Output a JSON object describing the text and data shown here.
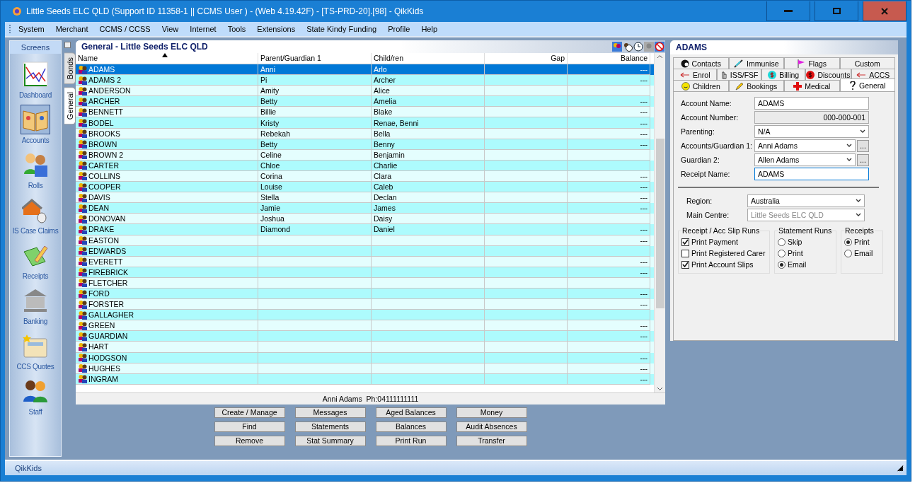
{
  "window": {
    "title": "Little Seeds ELC QLD (Support ID 11358-1 || CCMS User ) - (Web 4.19.42F) - [TS-PRD-20].[98] - QikKids"
  },
  "menu": [
    "System",
    "Merchant",
    "CCMS / CCSS",
    "View",
    "Internet",
    "Tools",
    "Extensions",
    "State Kindy Funding",
    "Profile",
    "Help"
  ],
  "sidebar": {
    "title": "Screens",
    "items": [
      {
        "label": "Dashboard",
        "kind": "chart",
        "selected": false
      },
      {
        "label": "Accounts",
        "kind": "book",
        "selected": true
      },
      {
        "label": "Rolls",
        "kind": "people",
        "selected": false
      },
      {
        "label": "IS Case Claims",
        "kind": "house",
        "selected": false
      },
      {
        "label": "Receipts",
        "kind": "pencil",
        "selected": false
      },
      {
        "label": "Banking",
        "kind": "bank",
        "selected": false
      },
      {
        "label": "CCS Quotes",
        "kind": "calc",
        "selected": false
      },
      {
        "label": "Staff",
        "kind": "staff",
        "selected": false
      }
    ]
  },
  "select_all": {
    "checked": false
  },
  "side_tabs": [
    {
      "label": "Bonds",
      "selected": false
    },
    {
      "label": "General",
      "selected": true
    }
  ],
  "list": {
    "title": "General - Little Seeds ELC QLD",
    "columns": [
      "Name",
      "Parent/Guardian 1",
      "Child/ren",
      "Gap",
      "Balance"
    ],
    "rows": [
      {
        "name": "ADAMS",
        "parent": "Anni",
        "children": "Arlo",
        "balance": "---",
        "selected": true
      },
      {
        "name": "ADAMS 2",
        "parent": "Pi",
        "children": "Archer",
        "balance": "---",
        "selected": false
      },
      {
        "name": "ANDERSON",
        "parent": "Amity",
        "children": "Alice",
        "selected": false
      },
      {
        "name": "ARCHER",
        "parent": "Betty",
        "children": "Amelia",
        "balance": "---",
        "selected": false
      },
      {
        "name": "BENNETT",
        "parent": "Billie",
        "children": "Blake",
        "balance": "---",
        "selected": false
      },
      {
        "name": "BODEL",
        "parent": "Kristy",
        "children": "Renae, Benni",
        "balance": "---",
        "selected": false
      },
      {
        "name": "BROOKS",
        "parent": "Rebekah",
        "children": "Bella",
        "balance": "---",
        "selected": false
      },
      {
        "name": "BROWN",
        "parent": "Betty",
        "children": "Benny",
        "balance": "---",
        "selected": false
      },
      {
        "name": "BROWN 2",
        "parent": "Celine",
        "children": "Benjamin",
        "selected": false
      },
      {
        "name": "CARTER",
        "parent": "Chloe",
        "children": "Charlie",
        "selected": false
      },
      {
        "name": "COLLINS",
        "parent": "Corina",
        "children": "Clara",
        "balance": "---",
        "selected": false
      },
      {
        "name": "COOPER",
        "parent": "Louise",
        "children": "Caleb",
        "balance": "---",
        "selected": false
      },
      {
        "name": "DAVIS",
        "parent": "Stella",
        "children": "Declan",
        "balance": "---",
        "selected": false
      },
      {
        "name": "DEAN",
        "parent": "Jamie",
        "children": "James",
        "balance": "---",
        "selected": false
      },
      {
        "name": "DONOVAN",
        "parent": "Joshua",
        "children": "Daisy",
        "selected": false
      },
      {
        "name": "DRAKE",
        "parent": "Diamond",
        "children": "Daniel",
        "balance": "---",
        "selected": false
      },
      {
        "name": "EASTON",
        "balance": "---",
        "selected": false
      },
      {
        "name": "EDWARDS",
        "selected": false
      },
      {
        "name": "EVERETT",
        "balance": "---",
        "selected": false
      },
      {
        "name": "FIREBRICK",
        "balance": "---",
        "selected": false
      },
      {
        "name": "FLETCHER",
        "selected": false
      },
      {
        "name": "FORD",
        "balance": "---",
        "selected": false
      },
      {
        "name": "FORSTER",
        "balance": "---",
        "selected": false
      },
      {
        "name": "GALLAGHER",
        "selected": false
      },
      {
        "name": "GREEN",
        "balance": "---",
        "selected": false
      },
      {
        "name": "GUARDIAN",
        "balance": "---",
        "selected": false
      },
      {
        "name": "HART",
        "selected": false
      },
      {
        "name": "HODGSON",
        "balance": "---",
        "selected": false
      },
      {
        "name": "HUGHES",
        "balance": "---",
        "selected": false
      },
      {
        "name": "INGRAM",
        "balance": "---",
        "selected": false
      }
    ],
    "footer": "Anni Adams  Ph:04111111111"
  },
  "buttons": [
    [
      "Create / Manage",
      "Messages",
      "Aged Balances",
      "Money"
    ],
    [
      "Find",
      "Statements",
      "Balances",
      "Audit Absences"
    ],
    [
      "Remove",
      "Stat Summary",
      "Print Run",
      "Transfer"
    ]
  ],
  "detail": {
    "title": "ADAMS",
    "tab_rows": [
      [
        {
          "label": "Contacts",
          "kind": "head",
          "selected": false
        },
        {
          "label": "Immunise",
          "kind": "syringe",
          "selected": false
        },
        {
          "label": "Flags",
          "kind": "flag",
          "selected": false
        },
        {
          "label": "Custom",
          "kind": "none",
          "selected": false
        }
      ],
      [
        {
          "label": "Enrol",
          "kind": "arrow",
          "selected": false
        },
        {
          "label": "ISS/FSF",
          "kind": "hand",
          "selected": false
        },
        {
          "label": "Billing",
          "kind": "dollar-cyan",
          "selected": false
        },
        {
          "label": "Discounts",
          "kind": "dollar-red",
          "selected": false
        },
        {
          "label": "ACCS",
          "kind": "arrow",
          "selected": false
        }
      ],
      [
        {
          "label": "Children",
          "kind": "smile",
          "selected": false
        },
        {
          "label": "Bookings",
          "kind": "pencil",
          "selected": false
        },
        {
          "label": "Medical",
          "kind": "cross",
          "selected": false
        },
        {
          "label": "General",
          "kind": "question",
          "selected": true
        }
      ]
    ],
    "fields": [
      {
        "label": "Account Name:",
        "kind": "text",
        "value": "ADAMS"
      },
      {
        "label": "Account Number:",
        "kind": "readonly",
        "value": "000-000-001"
      },
      {
        "label": "Parenting:",
        "kind": "select",
        "value": "N/A"
      },
      {
        "label": "Accounts/Guardian 1:",
        "kind": "picker",
        "value": "Anni Adams",
        "button": "..."
      },
      {
        "label": "Guardian 2:",
        "kind": "picker",
        "value": "Allen Adams",
        "button": "..."
      },
      {
        "label": "Receipt Name:",
        "kind": "focused",
        "value": "ADAMS"
      }
    ],
    "region_fields": [
      {
        "label": "Region:",
        "kind": "select",
        "value": "Australia"
      },
      {
        "label": "Main Centre:",
        "kind": "disabled",
        "value": "Little Seeds ELC QLD"
      }
    ],
    "groups": [
      {
        "title": "Receipt / Acc Slip Runs",
        "kind": "checkbox",
        "options": [
          {
            "label": "Print Payment",
            "checked": true
          },
          {
            "label": "Print Registered Carer",
            "checked": false
          },
          {
            "label": "Print Account Slips",
            "checked": true
          }
        ]
      },
      {
        "title": "Statement Runs",
        "kind": "radio",
        "options": [
          {
            "label": "Skip",
            "checked": false
          },
          {
            "label": "Print",
            "checked": false
          },
          {
            "label": "Email",
            "checked": true
          }
        ]
      },
      {
        "title": "Receipts",
        "kind": "radio",
        "options": [
          {
            "label": "Print",
            "checked": true
          },
          {
            "label": "Email",
            "checked": false
          }
        ]
      }
    ]
  },
  "status_bar": "QikKids"
}
